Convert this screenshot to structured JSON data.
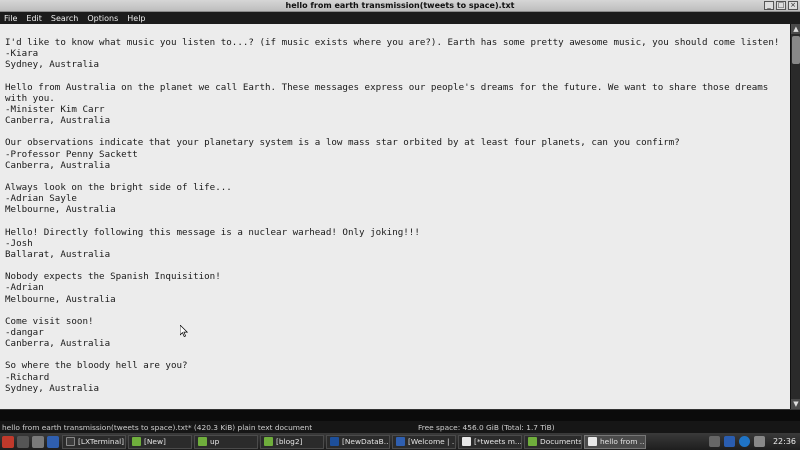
{
  "window": {
    "title": "hello from earth transmission(tweets to space).txt"
  },
  "menubar": [
    "File",
    "Edit",
    "Search",
    "Options",
    "Help"
  ],
  "entries": [
    [
      "I'd like to know what music you listen to...? (if music exists where you are?). Earth has some pretty awesome music, you should come listen!",
      "-Kiara",
      "Sydney, Australia"
    ],
    [
      "Hello from Australia on the planet we call Earth. These messages express our people's dreams for the future. We want to share those dreams with you.",
      "-Minister Kim Carr",
      "Canberra, Australia"
    ],
    [
      "Our observations indicate that your planetary system is a low mass star orbited by at least four planets, can you confirm?",
      "-Professor Penny Sackett",
      "Canberra, Australia"
    ],
    [
      "Always look on the bright side of life...",
      "-Adrian Sayle",
      "Melbourne, Australia"
    ],
    [
      "Hello! Directly following this message is a nuclear warhead! Only joking!!!",
      "-Josh",
      "Ballarat, Australia"
    ],
    [
      "Nobody expects the Spanish Inquisition!",
      "-Adrian",
      "Melbourne, Australia"
    ],
    [
      "Come visit soon!",
      "-dangar",
      "Canberra, Australia"
    ],
    [
      "So where the bloody hell are you?",
      "-Richard",
      "Sydney, Australia"
    ]
  ],
  "status": {
    "file_info": "hello from earth transmission(tweets to space).txt* (420.3 KiB) plain text document",
    "free_space": "Free space: 456.0 GiB (Total: 1.7 TiB)"
  },
  "taskbar": {
    "tasks": [
      {
        "label": "[LXTerminal]",
        "color": "#3c3c3c"
      },
      {
        "label": "[New]",
        "color": "#6fae3c"
      },
      {
        "label": "up",
        "color": "#6fae3c"
      },
      {
        "label": "[blog2]",
        "color": "#6fae3c"
      },
      {
        "label": "[NewDataB...",
        "color": "#1d4f9a"
      },
      {
        "label": "[Welcome | ...",
        "color": "#2f5fb0"
      },
      {
        "label": "[*tweets m...",
        "color": "#e8e8e8"
      },
      {
        "label": "Documents",
        "color": "#6fae3c"
      },
      {
        "label": "hello from ...",
        "color": "#e8e8e8"
      }
    ],
    "clock": "22:36"
  },
  "colors": {
    "editor_bg": "#ececec",
    "menubar_bg": "#1b1b1b",
    "taskbar_bg": "#2a2a2a"
  }
}
